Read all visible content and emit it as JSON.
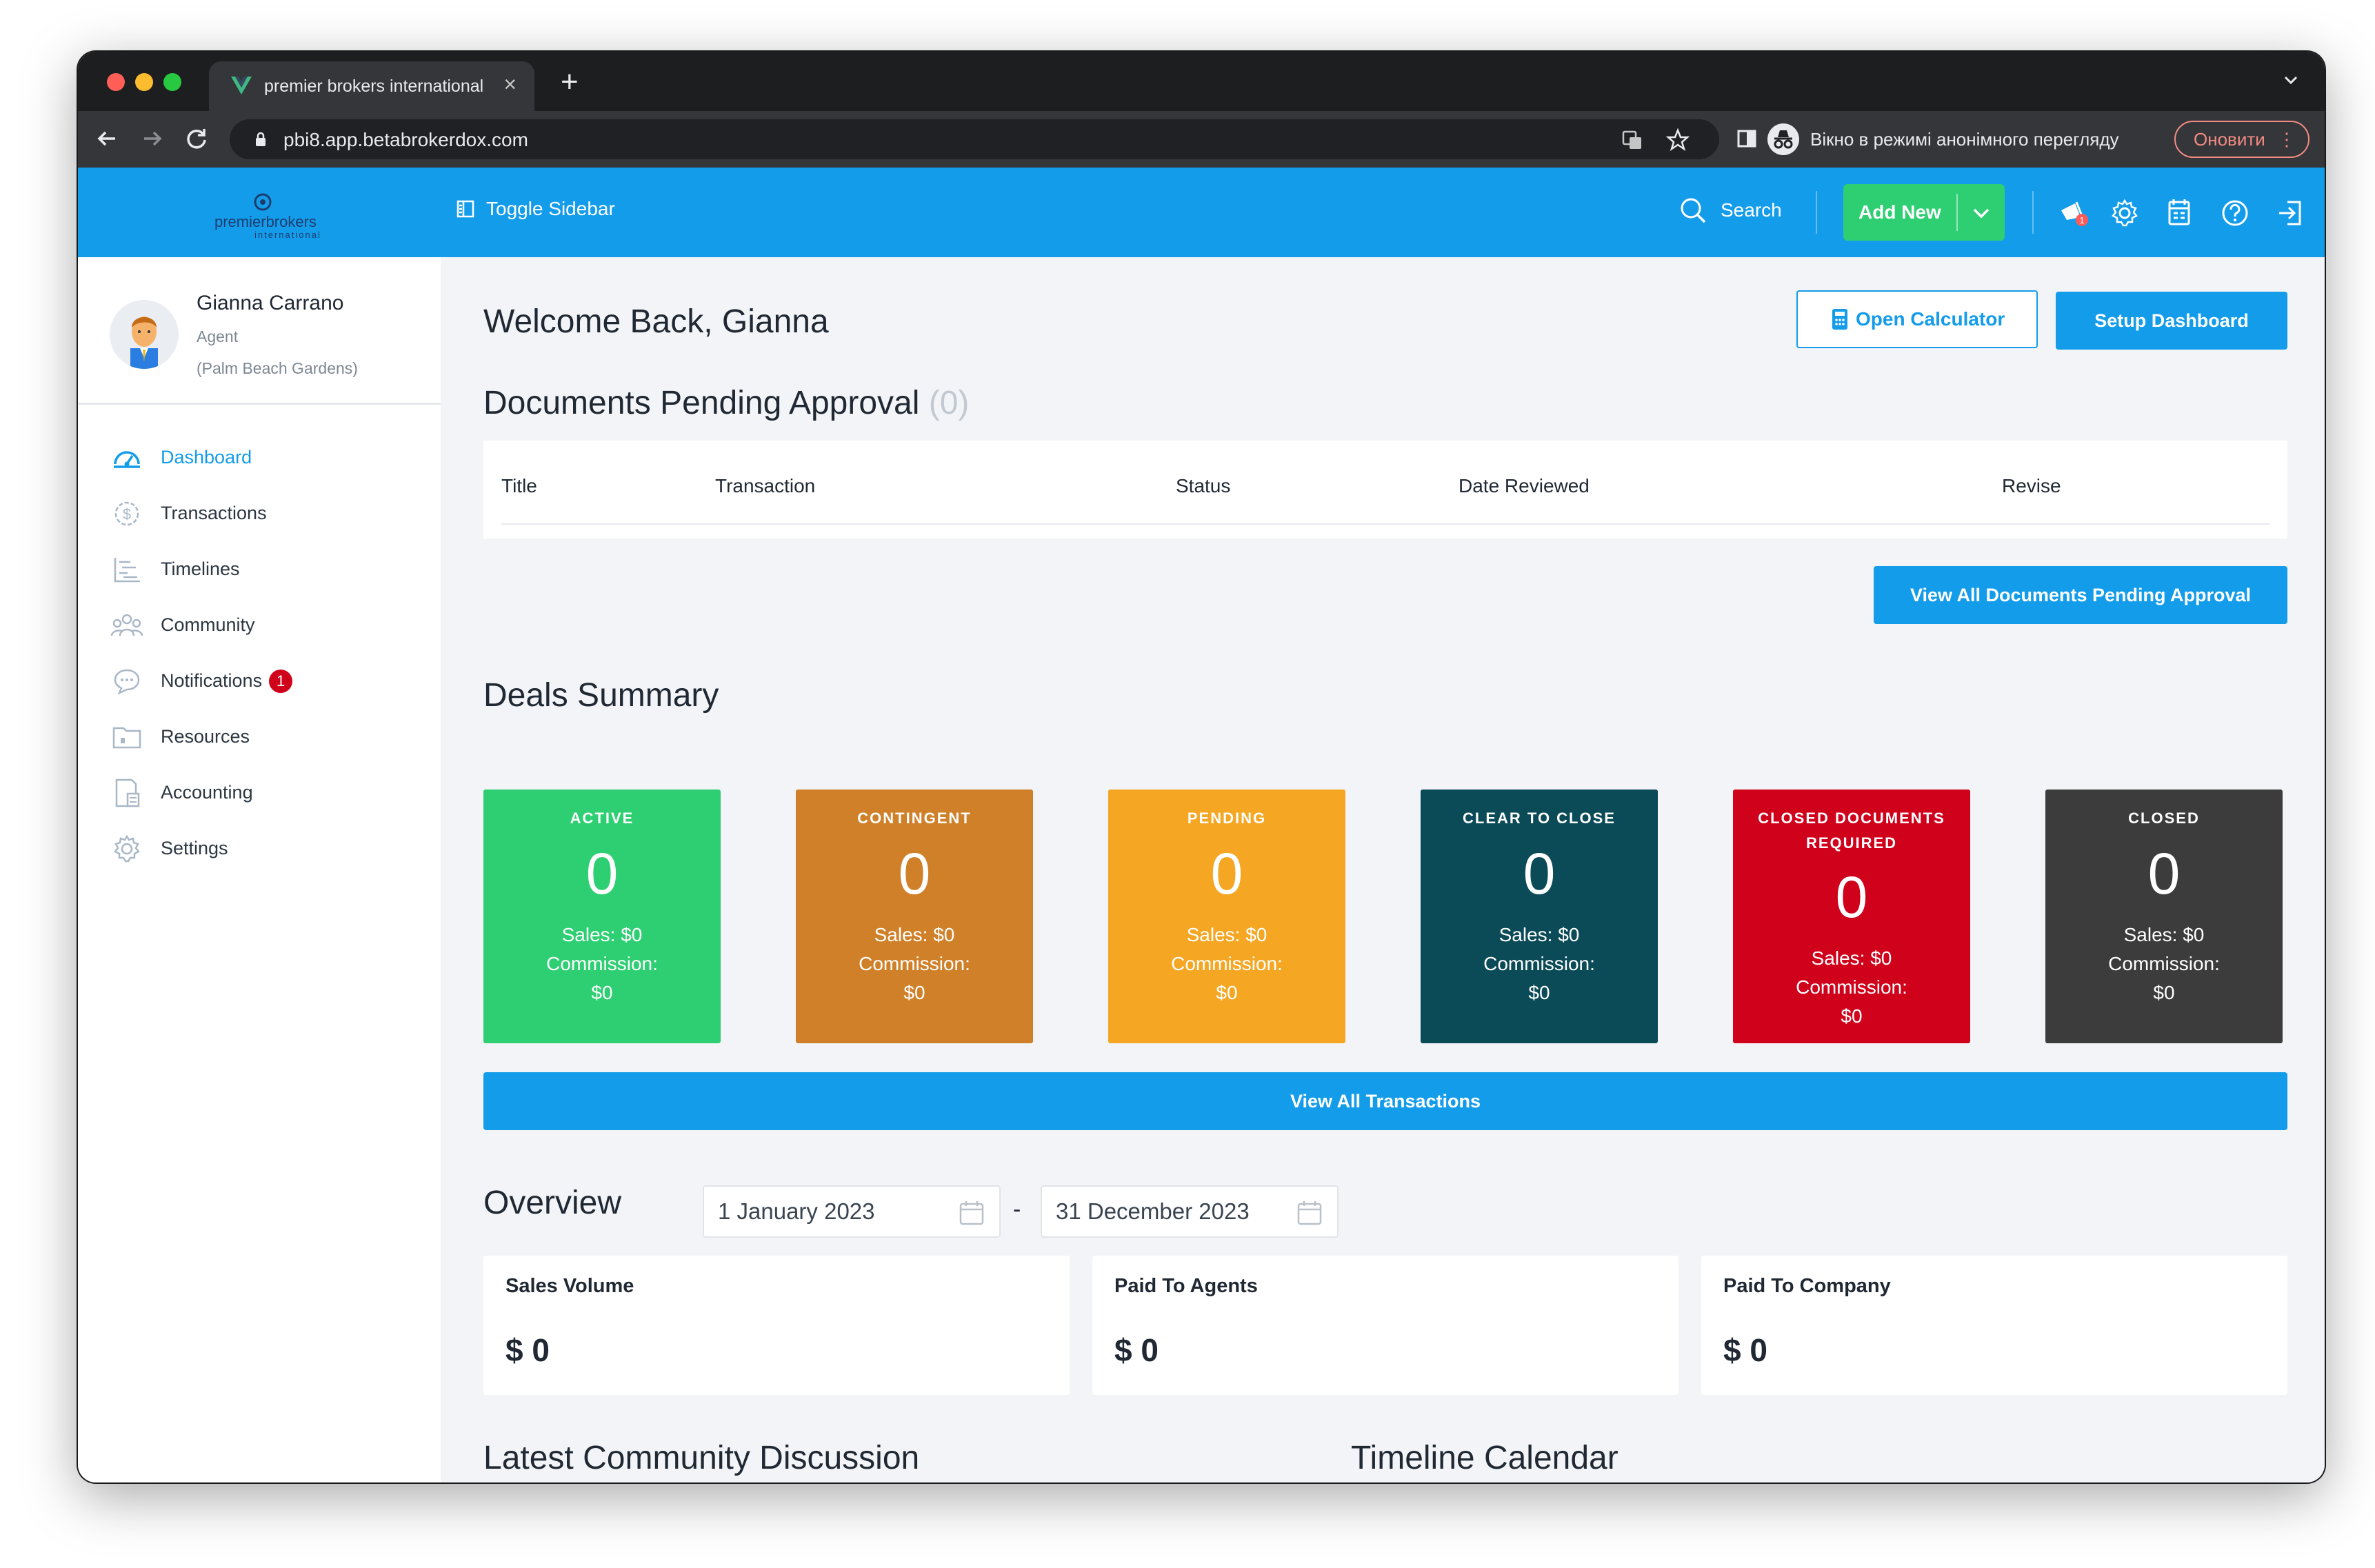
{
  "browser": {
    "tab_title": "premier brokers international",
    "tab_close": "×",
    "new_tab": "+",
    "url": "pbi8.app.betabrokerdox.com",
    "incognito_label": "Вікно в режимі анонімного перегляду",
    "update_label": "Оновити"
  },
  "topnav": {
    "logo_text": "premierbrokers",
    "logo_sub": "international",
    "toggle_sidebar": "Toggle Sidebar",
    "search": "Search",
    "add_new": "Add New",
    "notification_badge": "1"
  },
  "profile": {
    "name": "Gianna Carrano",
    "role": "Agent",
    "office": "(Palm Beach Gardens)"
  },
  "sidebar": {
    "items": [
      {
        "label": "Dashboard",
        "icon": "dashboard-icon",
        "active": true
      },
      {
        "label": "Transactions",
        "icon": "dollar-icon"
      },
      {
        "label": "Timelines",
        "icon": "timeline-icon"
      },
      {
        "label": "Community",
        "icon": "community-icon"
      },
      {
        "label": "Notifications",
        "icon": "chat-icon",
        "badge": "1"
      },
      {
        "label": "Resources",
        "icon": "folder-icon"
      },
      {
        "label": "Accounting",
        "icon": "accounting-icon"
      },
      {
        "label": "Settings",
        "icon": "gear-icon"
      }
    ]
  },
  "main": {
    "welcome": "Welcome Back, Gianna",
    "open_calculator": "Open Calculator",
    "setup_dashboard": "Setup Dashboard",
    "pending_title": "Documents Pending Approval",
    "pending_count": "(0)",
    "table_headers": [
      "Title",
      "Transaction",
      "Status",
      "Date Reviewed",
      "Revise"
    ],
    "view_all_pending": "View All Documents Pending Approval",
    "deals_title": "Deals Summary",
    "deals": [
      {
        "label": "ACTIVE",
        "count": "0",
        "sales": "Sales: $0",
        "commission_label": "Commission:",
        "commission": "$0",
        "color": "#2ecf72"
      },
      {
        "label": "CONTINGENT",
        "count": "0",
        "sales": "Sales: $0",
        "commission_label": "Commission:",
        "commission": "$0",
        "color": "#d08028"
      },
      {
        "label": "PENDING",
        "count": "0",
        "sales": "Sales: $0",
        "commission_label": "Commission:",
        "commission": "$0",
        "color": "#f5a623"
      },
      {
        "label": "CLEAR TO CLOSE",
        "count": "0",
        "sales": "Sales: $0",
        "commission_label": "Commission:",
        "commission": "$0",
        "color": "#0b4a57"
      },
      {
        "label_line1": "CLOSED DOCUMENTS",
        "label_line2": "REQUIRED",
        "count": "0",
        "sales": "Sales: $0",
        "commission_label": "Commission:",
        "commission": "$0",
        "color": "#d0021b"
      },
      {
        "label": "CLOSED",
        "count": "0",
        "sales": "Sales: $0",
        "commission_label": "Commission:",
        "commission": "$0",
        "color": "#3c3c3c"
      }
    ],
    "view_all_transactions": "View All Transactions",
    "overview_title": "Overview",
    "date_from": "1 January 2023",
    "date_sep": "-",
    "date_to": "31 December 2023",
    "stats": [
      {
        "title": "Sales Volume",
        "value": "$ 0"
      },
      {
        "title": "Paid To Agents",
        "value": "$ 0"
      },
      {
        "title": "Paid To Company",
        "value": "$ 0"
      }
    ],
    "community_title": "Latest Community Discussion",
    "timeline_title": "Timeline Calendar"
  },
  "colors": {
    "brand_blue": "#139cea",
    "add_green": "#2ecf72",
    "danger": "#d0021b"
  }
}
